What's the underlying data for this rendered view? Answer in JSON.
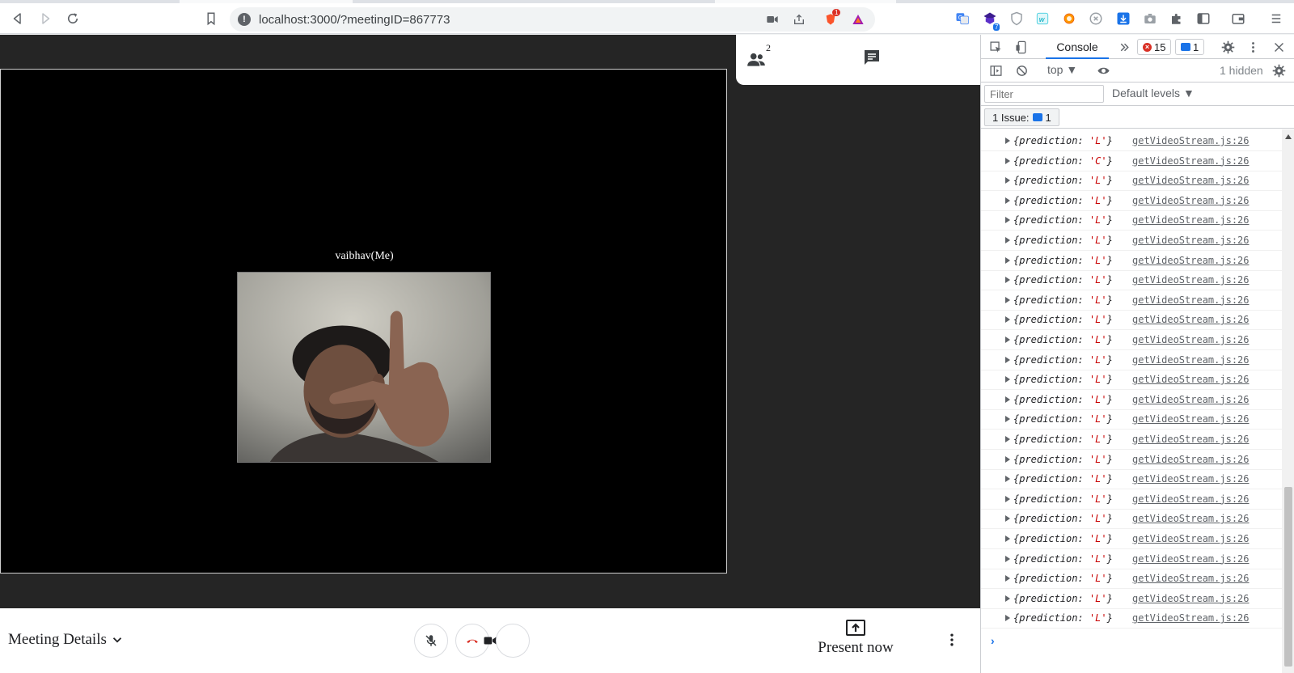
{
  "browser": {
    "url": "localhost:3000/?meetingID=867773",
    "icons": [
      "back-icon",
      "forward-icon",
      "reload-icon",
      "bookmark-icon",
      "info-icon",
      "camera-icon",
      "share-icon",
      "brave-shield-icon",
      "brave-rewards-icon",
      "translate-icon",
      "extension-badge-icon",
      "shield-ext-icon",
      "w-ext-icon",
      "color-ext-icon",
      "moon-ext-icon",
      "download-icon",
      "screenshot-icon",
      "puzzle-icon",
      "sidebar-icon",
      "wallet-icon",
      "menu-icon"
    ],
    "brave_badge": "1",
    "ext_badge": "7"
  },
  "meeting": {
    "participants_count": "2",
    "self_label": "vaibhav(Me)",
    "meeting_details_label": "Meeting Details",
    "present_now_label": "Present now",
    "controls": [
      "mic-off-icon",
      "end-call-icon",
      "video-icon"
    ]
  },
  "devtools": {
    "tab_console": "Console",
    "error_count": "15",
    "message_count": "1",
    "context": "top",
    "hidden_text": "1 hidden",
    "filter_placeholder": "Filter",
    "levels_label": "Default levels",
    "issue_label": "1 Issue:",
    "issue_count": "1",
    "log_entries": [
      {
        "prefix": "{prediction: ",
        "value": "'L'",
        "suffix": "}",
        "source": "getVideoStream.js:26"
      },
      {
        "prefix": "{prediction: ",
        "value": "'C'",
        "suffix": "}",
        "source": "getVideoStream.js:26"
      },
      {
        "prefix": "{prediction: ",
        "value": "'L'",
        "suffix": "}",
        "source": "getVideoStream.js:26"
      },
      {
        "prefix": "{prediction: ",
        "value": "'L'",
        "suffix": "}",
        "source": "getVideoStream.js:26"
      },
      {
        "prefix": "{prediction: ",
        "value": "'L'",
        "suffix": "}",
        "source": "getVideoStream.js:26"
      },
      {
        "prefix": "{prediction: ",
        "value": "'L'",
        "suffix": "}",
        "source": "getVideoStream.js:26"
      },
      {
        "prefix": "{prediction: ",
        "value": "'L'",
        "suffix": "}",
        "source": "getVideoStream.js:26"
      },
      {
        "prefix": "{prediction: ",
        "value": "'L'",
        "suffix": "}",
        "source": "getVideoStream.js:26"
      },
      {
        "prefix": "{prediction: ",
        "value": "'L'",
        "suffix": "}",
        "source": "getVideoStream.js:26"
      },
      {
        "prefix": "{prediction: ",
        "value": "'L'",
        "suffix": "}",
        "source": "getVideoStream.js:26"
      },
      {
        "prefix": "{prediction: ",
        "value": "'L'",
        "suffix": "}",
        "source": "getVideoStream.js:26"
      },
      {
        "prefix": "{prediction: ",
        "value": "'L'",
        "suffix": "}",
        "source": "getVideoStream.js:26"
      },
      {
        "prefix": "{prediction: ",
        "value": "'L'",
        "suffix": "}",
        "source": "getVideoStream.js:26"
      },
      {
        "prefix": "{prediction: ",
        "value": "'L'",
        "suffix": "}",
        "source": "getVideoStream.js:26"
      },
      {
        "prefix": "{prediction: ",
        "value": "'L'",
        "suffix": "}",
        "source": "getVideoStream.js:26"
      },
      {
        "prefix": "{prediction: ",
        "value": "'L'",
        "suffix": "}",
        "source": "getVideoStream.js:26"
      },
      {
        "prefix": "{prediction: ",
        "value": "'L'",
        "suffix": "}",
        "source": "getVideoStream.js:26"
      },
      {
        "prefix": "{prediction: ",
        "value": "'L'",
        "suffix": "}",
        "source": "getVideoStream.js:26"
      },
      {
        "prefix": "{prediction: ",
        "value": "'L'",
        "suffix": "}",
        "source": "getVideoStream.js:26"
      },
      {
        "prefix": "{prediction: ",
        "value": "'L'",
        "suffix": "}",
        "source": "getVideoStream.js:26"
      },
      {
        "prefix": "{prediction: ",
        "value": "'L'",
        "suffix": "}",
        "source": "getVideoStream.js:26"
      },
      {
        "prefix": "{prediction: ",
        "value": "'L'",
        "suffix": "}",
        "source": "getVideoStream.js:26"
      },
      {
        "prefix": "{prediction: ",
        "value": "'L'",
        "suffix": "}",
        "source": "getVideoStream.js:26"
      },
      {
        "prefix": "{prediction: ",
        "value": "'L'",
        "suffix": "}",
        "source": "getVideoStream.js:26"
      },
      {
        "prefix": "{prediction: ",
        "value": "'L'",
        "suffix": "}",
        "source": "getVideoStream.js:26"
      }
    ],
    "prompt_symbol": "›"
  }
}
